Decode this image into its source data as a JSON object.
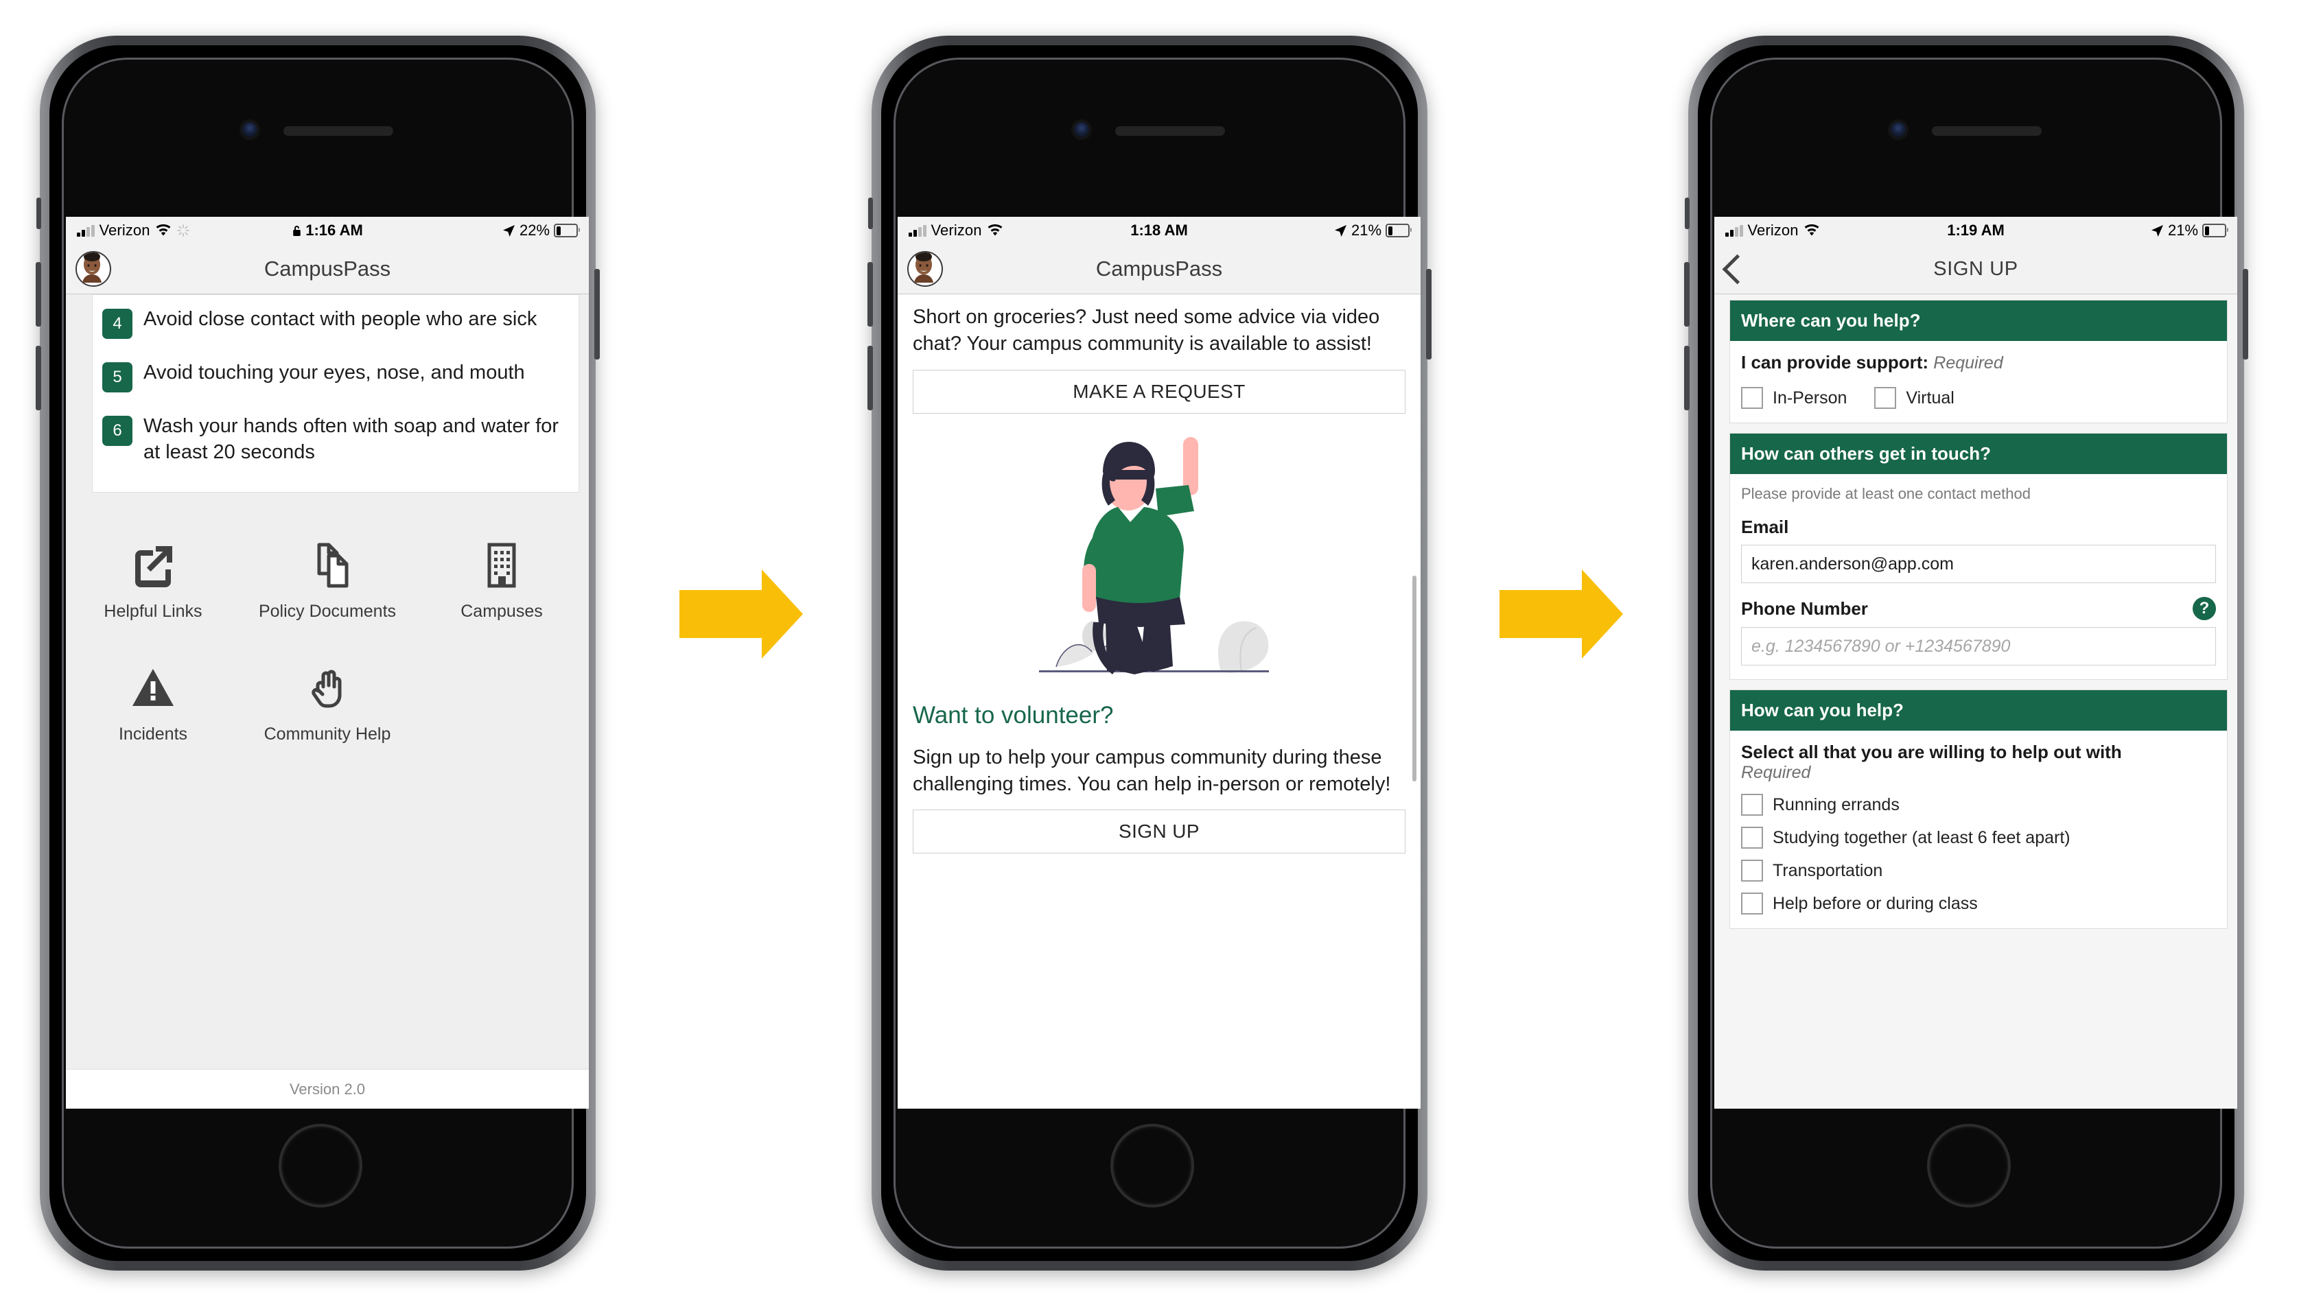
{
  "colors": {
    "brand_green": "#17674a",
    "arrow_yellow": "#f9bf08",
    "status_bar_bg": "#f2f2f2"
  },
  "phone1": {
    "status": {
      "carrier": "Verizon",
      "wifi_icon": "wifi-icon",
      "spinner_icon": "activity-spinner-icon",
      "lock_icon": "lock-icon",
      "time": "1:16 AM",
      "location_icon": "location-arrow-icon",
      "battery_percent": "22%"
    },
    "nav": {
      "title": "CampusPass",
      "avatar": "user-avatar"
    },
    "tips": [
      {
        "num": "4",
        "text": "Avoid close contact with people who are sick"
      },
      {
        "num": "5",
        "text": "Avoid touching your eyes, nose, and mouth"
      },
      {
        "num": "6",
        "text": "Wash your hands often with soap and water for at least 20 seconds"
      }
    ],
    "grid": [
      {
        "icon": "external-link-icon",
        "label": "Helpful Links"
      },
      {
        "icon": "documents-icon",
        "label": "Policy Documents"
      },
      {
        "icon": "building-icon",
        "label": "Campuses"
      },
      {
        "icon": "warning-triangle-icon",
        "label": "Incidents"
      },
      {
        "icon": "raised-hand-icon",
        "label": "Community Help"
      }
    ],
    "version": "Version 2.0"
  },
  "phone2": {
    "status": {
      "carrier": "Verizon",
      "wifi_icon": "wifi-icon",
      "time": "1:18 AM",
      "location_icon": "location-arrow-icon",
      "battery_percent": "21%"
    },
    "nav": {
      "title": "CampusPass",
      "avatar": "user-avatar"
    },
    "intro": "Short on groceries? Just need some advice via video chat? Your campus community is available to assist!",
    "request_button": "MAKE A REQUEST",
    "illustration": "person-raising-hand-illustration",
    "volunteer_heading": "Want to volunteer?",
    "volunteer_text": "Sign up to help your campus community during these challenging times. You can help in-person or remotely!",
    "signup_button": "SIGN UP"
  },
  "phone3": {
    "status": {
      "carrier": "Verizon",
      "wifi_icon": "wifi-icon",
      "time": "1:19 AM",
      "location_icon": "location-arrow-icon",
      "battery_percent": "21%"
    },
    "nav": {
      "title": "SIGN UP",
      "back_icon": "back-chevron-icon"
    },
    "section_where": {
      "header": "Where can you help?",
      "label": "I can provide support:",
      "required": "Required",
      "options": [
        "In-Person",
        "Virtual"
      ]
    },
    "section_contact": {
      "header": "How can others get in touch?",
      "hint": "Please provide at least one contact method",
      "email_label": "Email",
      "email_value": "karen.anderson@app.com",
      "phone_label": "Phone Number",
      "phone_placeholder": "e.g. 1234567890 or +1234567890",
      "help_icon": "help-question-icon"
    },
    "section_help": {
      "header": "How can you help?",
      "label": "Select all that you are willing to help out with",
      "required": "Required",
      "options": [
        "Running errands",
        "Studying together (at least 6 feet apart)",
        "Transportation",
        "Help before or during class"
      ]
    }
  },
  "arrows": {
    "a1": "right-arrow-icon",
    "a2": "right-arrow-icon"
  }
}
